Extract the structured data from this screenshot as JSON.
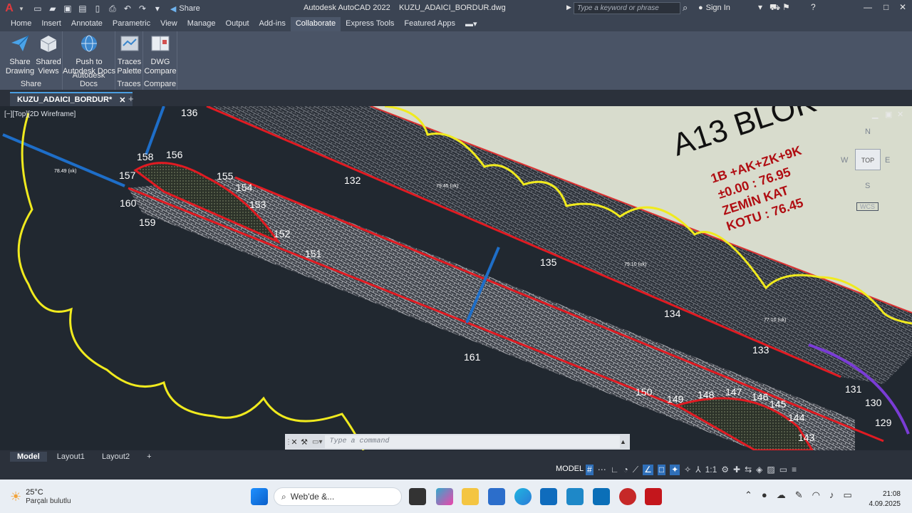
{
  "app": {
    "title": "Autodesk AutoCAD 2022",
    "filename": "KUZU_ADAICI_BORDUR.dwg",
    "share": "Share",
    "search_placeholder": "Type a keyword or phrase",
    "signin": "Sign In",
    "logo": "A"
  },
  "menu": [
    "Home",
    "Insert",
    "Annotate",
    "Parametric",
    "View",
    "Manage",
    "Output",
    "Add-ins",
    "Collaborate",
    "Express Tools",
    "Featured Apps"
  ],
  "active_menu": "Collaborate",
  "ribbon": {
    "buttons": [
      {
        "l1": "Share",
        "l2": "Drawing"
      },
      {
        "l1": "Shared",
        "l2": "Views"
      },
      {
        "l1": "Push to",
        "l2": "Autodesk Docs"
      },
      {
        "l1": "Traces",
        "l2": "Palette"
      },
      {
        "l1": "DWG",
        "l2": "Compare"
      }
    ],
    "groups": [
      "Share",
      "Autodesk Docs",
      "Traces",
      "Compare"
    ]
  },
  "file_tab": {
    "name": "KUZU_ADAICI_BORDUR*",
    "close": "✕",
    "add": "+"
  },
  "viewport": {
    "label": "[−][Top][2D Wireframe]"
  },
  "viewcube": {
    "top": "TOP",
    "n": "N",
    "s": "S",
    "e": "E",
    "w": "W",
    "wcs": "WCS"
  },
  "drawing": {
    "block_title": "A13 BLOK",
    "block_lines": [
      "1B +AK+ZK+9K",
      "±0.00 : 76.95",
      "ZEMİN KAT",
      "KOTU : 76.45"
    ],
    "point_labels": [
      "136",
      "158",
      "156",
      "157",
      "155",
      "154",
      "160",
      "153",
      "159",
      "152",
      "151",
      "132",
      "135",
      "134",
      "133",
      "161",
      "150",
      "149",
      "148",
      "147",
      "146",
      "145",
      "144",
      "143",
      "131",
      "130",
      "129"
    ],
    "elev_labels": [
      "78.49 (ıık)",
      "79.45 (ıık)",
      "79.10 (ıık)",
      "77.10 (ıık)"
    ]
  },
  "command": {
    "placeholder": "Type a command"
  },
  "layouts": [
    "Model",
    "Layout1",
    "Layout2"
  ],
  "status": {
    "model": "MODEL",
    "scale": "1:1"
  },
  "taskbar": {
    "temp": "25°C",
    "weather": "Parçalı bulutlu",
    "search": "Web'de &...",
    "time": "21:08",
    "date": "4.09.2025"
  }
}
